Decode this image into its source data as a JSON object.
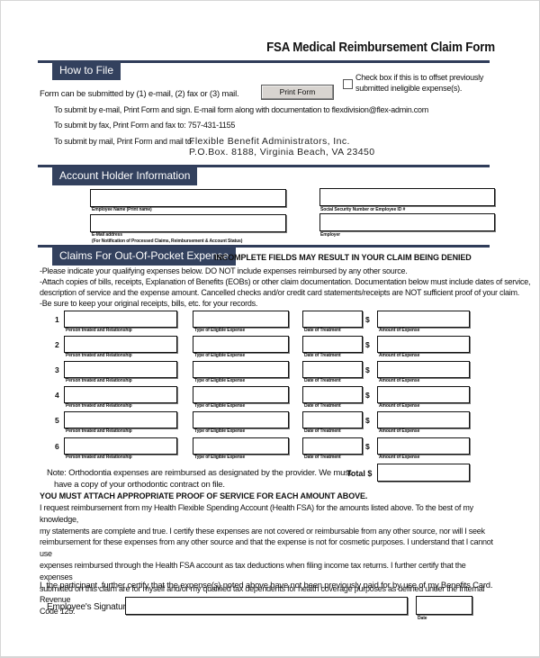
{
  "document": {
    "title": "FSA Medical Reimbursement Claim Form"
  },
  "how_to_file": {
    "header": "How to File",
    "intro": "Form can be submitted by  (1) e-mail, (2) fax or (3) mail.",
    "print_button": "Print Form",
    "offset_checkbox_label_line1": "Check box if this is to offset previously",
    "offset_checkbox_label_line2": "submitted ineligible expense(s).",
    "offset_checkbox_checked": false,
    "email_instructions": "To submit by e-mail, Print Form and sign.  E-mail form along with documentation to flexdivision@flex-admin.com",
    "fax_instructions": "To submit by fax, Print Form and fax to: 757-431-1155",
    "mail_instructions": "To submit by mail, Print Form and mail to:",
    "mail_address_line1": "Flexible Benefit Administrators, Inc.",
    "mail_address_line2": "P.O.Box. 8188, Virginia Beach, VA 23450"
  },
  "account_holder": {
    "header": "Account Holder Information",
    "fields": {
      "employee_name": {
        "label": "Employee Name (Print name)",
        "value": ""
      },
      "ssn": {
        "label": "Social Security Number or Employee ID #",
        "value": ""
      },
      "email": {
        "label": "E-Mail address",
        "sublabel": "(For Notification of Processed Claims, Reimbursement & Account Status)",
        "value": ""
      },
      "employer": {
        "label": "Employer",
        "value": ""
      }
    }
  },
  "claims": {
    "header": "Claims For Out-Of-Pocket Expense",
    "warning": "INCOMPLETE FIELDS MAY RESULT IN YOUR CLAIM BEING DENIED",
    "instructions": [
      "-Please indicate your qualifying expenses below.  DO NOT include expenses reimbursed by any other source.",
      "-Attach copies of bills, receipts, Explanation of Benefits (EOBs) or other claim documentation.  Documentation below must include dates of service,",
      "description of service and the expense amount.  Cancelled checks and/or credit card statements/receipts are NOT sufficient proof of your claim.",
      "-Be sure to keep your original receipts, bills, etc. for your records."
    ],
    "column_labels": {
      "person": "Person treated and Relationship",
      "type": "Type of Eligible Expense",
      "date": "Date of Treatment",
      "amount": "Amount of Expense"
    },
    "currency_symbol": "$",
    "rows": [
      {
        "number": "1",
        "person": "",
        "type": "",
        "date": "",
        "amount": ""
      },
      {
        "number": "2",
        "person": "",
        "type": "",
        "date": "",
        "amount": ""
      },
      {
        "number": "3",
        "person": "",
        "type": "",
        "date": "",
        "amount": ""
      },
      {
        "number": "4",
        "person": "",
        "type": "",
        "date": "",
        "amount": ""
      },
      {
        "number": "5",
        "person": "",
        "type": "",
        "date": "",
        "amount": ""
      },
      {
        "number": "6",
        "person": "",
        "type": "",
        "date": "",
        "amount": ""
      }
    ],
    "note_line1": "Note: Orthodontia expenses are reimbursed as designated by the provider.  We must",
    "note_line2": "have a copy of your orthodontic contract on file.",
    "total_label": "Total $",
    "total_value": ""
  },
  "certification": {
    "proof_heading": "YOU MUST ATTACH APPROPRIATE PROOF OF SERVICE FOR EACH AMOUNT ABOVE.",
    "lines": [
      "I request reimbursement from my Health Flexible Spending Account (Health FSA) for the amounts listed above. To the best of my knowledge,",
      "my statements are complete and true. I certify these expenses are not covered or reimbursable from any other source, nor will I seek",
      "reimbursement for these expenses from any other source and that the expense is not for cosmetic purposes. I understand that I cannot use",
      "expenses reimbursed through the Health FSA account as tax deductions when filing income tax returns. I further certify that the expenses",
      "submitted on this claim are for myself and/or my qualified tax dependents for health coverage purposes as defined under the Internal Revenue",
      "Code 125."
    ],
    "benefits_card_statement": "I, the participant, further certify that the expense(s) noted above have not been previously paid for by use of my Benefits Card.",
    "signature_label": "Employee's Signature:",
    "signature_value": "",
    "date_label": "Date",
    "date_value": ""
  }
}
